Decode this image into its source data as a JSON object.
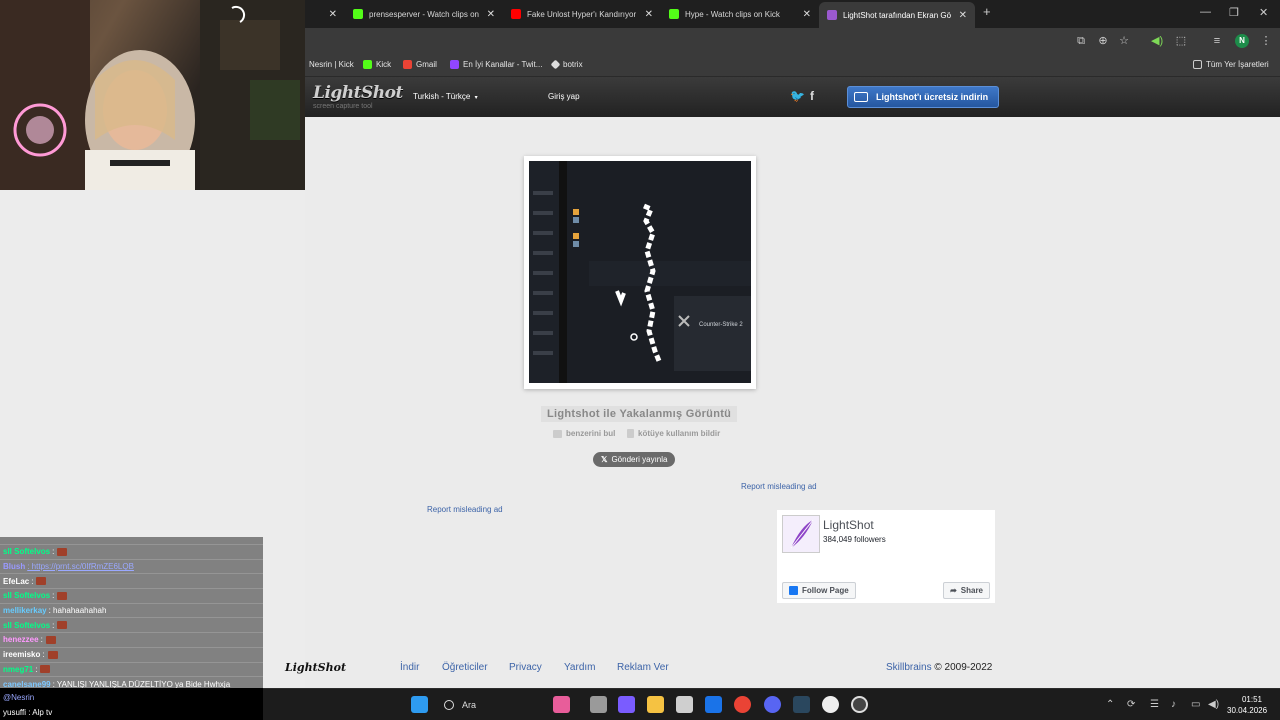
{
  "browser": {
    "tabs": [
      {
        "title": "",
        "color": "#1f1f1f"
      },
      {
        "title": "prensesperver - Watch clips on",
        "color": "#53fc18"
      },
      {
        "title": "Fake Unlost Hyper'ı Kandırıyor",
        "color": "#ff0000"
      },
      {
        "title": "Hype - Watch clips on Kick",
        "color": "#53fc18"
      },
      {
        "title": "LightShot tarafından Ekran Gör",
        "color": "#9b59d0"
      }
    ],
    "new_tab": "+",
    "profile_initial": "N",
    "bookmarks": [
      {
        "label": "Nesrin | Kick",
        "color": ""
      },
      {
        "label": "Kick",
        "color": "#53fc18"
      },
      {
        "label": "Gmail",
        "color": "#ea4335"
      },
      {
        "label": "En İyi Kanallar - Twit...",
        "color": "#9146ff"
      },
      {
        "label": "botrix",
        "color": "#dddddd"
      }
    ],
    "all_bookmarks": "Tüm Yer İşaretleri"
  },
  "lightshot": {
    "logo": "LightShot",
    "tagline": "screen capture tool",
    "language": "Turkish - Türkçe",
    "login": "Giriş yap",
    "download_button": "Lightshot'ı ücretsiz indirin",
    "screenshot_title": "Lightshot ile Yakalanmış Görüntü",
    "similar_link": "benzerini bul",
    "abuse_link": "kötüye kullanım bildir",
    "tweet_button": "Gönderi yayınla",
    "report_ad_right": "Report misleading ad",
    "report_ad_left": "Report misleading ad",
    "screenshot_text": "Counter-Strike 2",
    "footer": {
      "logo": "LightShot",
      "nav": [
        "İndir",
        "Öğreticiler",
        "Privacy",
        "Yardım",
        "Reklam Ver"
      ],
      "company": "Skillbrains",
      "copyright": " © 2009-2022"
    }
  },
  "facebook": {
    "page_name": "LightShot",
    "followers": "384,049 followers",
    "follow_button": "Follow Page",
    "share_button": "Share"
  },
  "chat": {
    "lines": [
      {
        "user": "",
        "message": "",
        "user_color": "#7ec8ff"
      },
      {
        "user": "sll Softelvos",
        "message": ":",
        "user_color": "#00ff88"
      },
      {
        "user": "Blush",
        "message": ": https://prnt.sc/0IfRmZE6LQB",
        "user_color": "#9999ff"
      },
      {
        "user": "EfeLac",
        "message": ":",
        "user_color": "#ffffff"
      },
      {
        "user": "sll Softelvos",
        "message": ":",
        "user_color": "#00ff88"
      },
      {
        "user": "mellikerkay",
        "message": ": hahahaahahah",
        "user_color": "#66ccff"
      },
      {
        "user": "sll Softelvos",
        "message": ":",
        "user_color": "#00ff88"
      },
      {
        "user": "henezzee",
        "message": ":",
        "user_color": "#ff99ff"
      },
      {
        "user": "ireemisko",
        "message": ":",
        "user_color": "#ffffff"
      },
      {
        "user": "nmeg71",
        "message": ":",
        "user_color": "#00ff88"
      },
      {
        "user": "canelsane99",
        "message": ": YANLIŞI YANLIŞLA DÜZELTİYO ya Bide Hwhxja",
        "user_color": "#7ec8ff"
      }
    ],
    "mention": "@Nesrin",
    "last_message": "yusuffi : Alp tv"
  },
  "taskbar": {
    "search_placeholder": "Ara",
    "time": "01:51",
    "date": "30.04.2026"
  }
}
